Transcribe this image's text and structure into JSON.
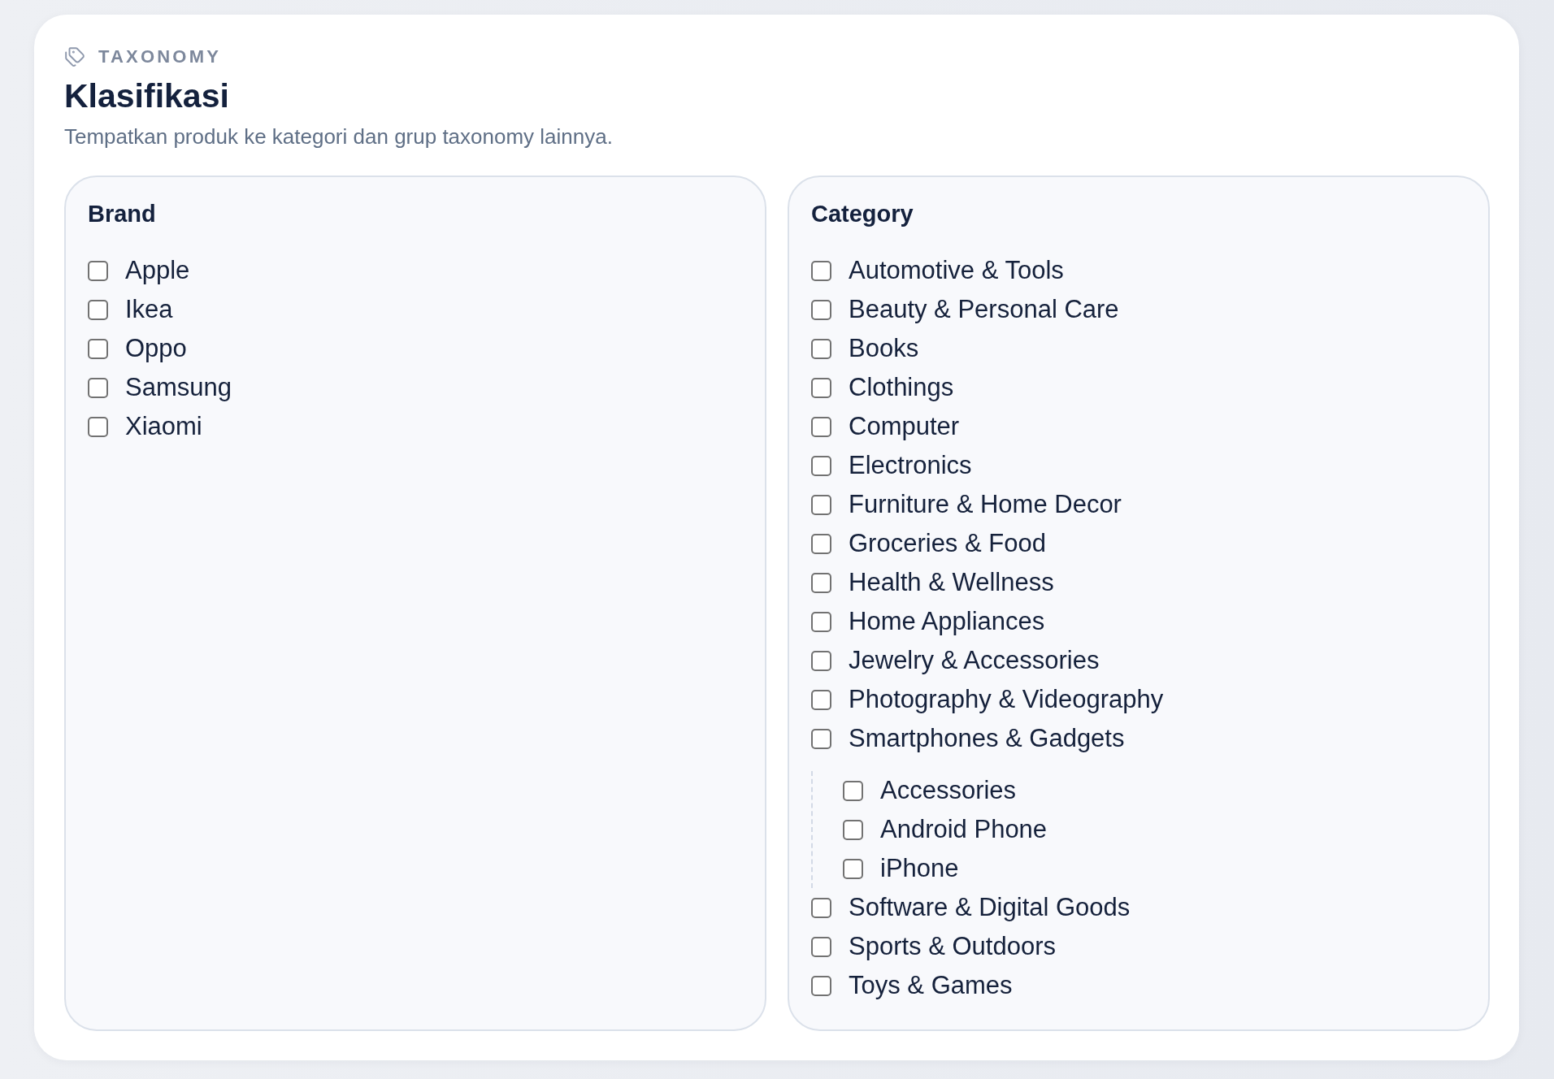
{
  "header": {
    "eyebrow": "TAXONOMY",
    "title": "Klasifikasi",
    "subtitle": "Tempatkan produk ke kategori dan grup taxonomy lainnya."
  },
  "panels": [
    {
      "title": "Brand",
      "items": [
        {
          "label": "Apple",
          "checked": false
        },
        {
          "label": "Ikea",
          "checked": false
        },
        {
          "label": "Oppo",
          "checked": false
        },
        {
          "label": "Samsung",
          "checked": false
        },
        {
          "label": "Xiaomi",
          "checked": false
        }
      ]
    },
    {
      "title": "Category",
      "items": [
        {
          "label": "Automotive & Tools",
          "checked": false
        },
        {
          "label": "Beauty & Personal Care",
          "checked": false
        },
        {
          "label": "Books",
          "checked": false
        },
        {
          "label": "Clothings",
          "checked": false
        },
        {
          "label": "Computer",
          "checked": false
        },
        {
          "label": "Electronics",
          "checked": false
        },
        {
          "label": "Furniture & Home Decor",
          "checked": false
        },
        {
          "label": "Groceries & Food",
          "checked": false
        },
        {
          "label": "Health & Wellness",
          "checked": false
        },
        {
          "label": "Home Appliances",
          "checked": false
        },
        {
          "label": "Jewelry & Accessories",
          "checked": false
        },
        {
          "label": "Photography & Videography",
          "checked": false
        },
        {
          "label": "Smartphones & Gadgets",
          "checked": false,
          "children": [
            {
              "label": "Accessories",
              "checked": false
            },
            {
              "label": "Android Phone",
              "checked": false
            },
            {
              "label": "iPhone",
              "checked": false
            }
          ]
        },
        {
          "label": "Software & Digital Goods",
          "checked": false
        },
        {
          "label": "Sports & Outdoors",
          "checked": false
        },
        {
          "label": "Toys & Games",
          "checked": false
        }
      ]
    }
  ]
}
